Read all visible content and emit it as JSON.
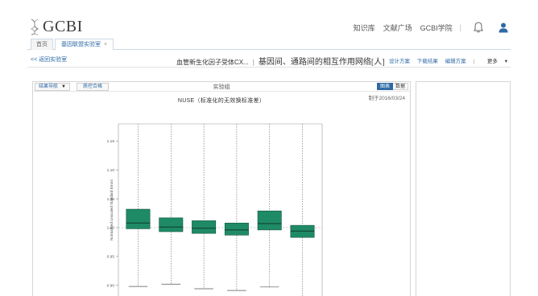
{
  "header": {
    "logo_text": "GCBI",
    "nav": [
      "知识库",
      "文献广场",
      "GCBI学院"
    ],
    "separator": "|",
    "accent_color": "#2e6aa5"
  },
  "tabs": {
    "home_label": "首页",
    "active_label": "基因联盟实验室",
    "close_glyph": "×"
  },
  "toolbar": {
    "back_label": "<< 返回实验室",
    "crumb_prefix": "血管新生化因子受体CX...",
    "crumb_divider": "|",
    "crumb_title": "基因间、通路间的相互作用网络[人]",
    "actions": [
      "设计方案",
      "下载结果",
      "编辑方案"
    ],
    "actions_sep": "|",
    "more_label": "更多"
  },
  "panel": {
    "dropdown_label": "结果导航",
    "tab_button_label": "质控合格",
    "title": "实验组",
    "toggle_on": "图表",
    "toggle_off": "数据"
  },
  "chart_data": {
    "type": "boxplot",
    "title": "NUSE（标准化的无效换标准差）",
    "date_label": "制于2016/03/24",
    "ylabel": "Normalized Unscaled Standard Errors",
    "ylim": [
      0.88,
      1.18
    ],
    "yticks": [
      "0.90",
      "0.95",
      "1.00",
      "1.05",
      "1.10",
      "1.15"
    ],
    "reference_line": 1.0,
    "box_color": "#1f8a66",
    "boxes": [
      {
        "q1": 0.998,
        "median": 1.008,
        "q3": 1.032,
        "whisker_low": 0.898
      },
      {
        "q1": 0.993,
        "median": 1.001,
        "q3": 1.017,
        "whisker_low": 0.902
      },
      {
        "q1": 0.99,
        "median": 0.999,
        "q3": 1.012,
        "whisker_low": 0.894
      },
      {
        "q1": 0.987,
        "median": 0.996,
        "q3": 1.008,
        "whisker_low": 0.891
      },
      {
        "q1": 0.996,
        "median": 1.007,
        "q3": 1.029,
        "whisker_low": 0.897
      },
      {
        "q1": 0.983,
        "median": 0.994,
        "q3": 1.004,
        "whisker_low": 0.88
      }
    ]
  }
}
